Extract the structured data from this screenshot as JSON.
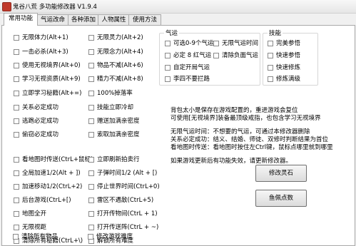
{
  "window": {
    "title": "鬼谷八荒 多功能修改器  V1.9.4"
  },
  "tabs": [
    "常用功能",
    "气运改命",
    "各种添加",
    "人物属性",
    "使用方法"
  ],
  "left_col": [
    "无限体力(Alt+1)",
    "一击必杀(Alt+3)",
    "使用无视境界(Alt+0)",
    "学习无视资质(Alt+9)",
    "立即学习秘籍(Alt+=)",
    "关系必定成功",
    "逃跑必定成功",
    "偷窃必定成功"
  ],
  "mid_col": [
    "无限灵力(Alt+2)",
    "无限念力(Alt+4)",
    "物品不减(Alt+6)",
    "精力不减(Alt+8)",
    "100%掉落率",
    "技能立即冷却",
    "赠送加满亲密度",
    "索取加满亲密度"
  ],
  "left_col2": [
    "看地图时传送(CtrL+鼠标)",
    "全局加速1/2(Alt + ])",
    "加速移动1/2(CtrL+2)",
    "后台游戏(CtrL+[)",
    "地图全开",
    "无限视距",
    "清除所有秘籍(CtrL+\\)",
    "清除所有物品"
  ],
  "mid_col2": [
    "立即刷新拍卖行",
    "子弹时间1/2 (Alt + [)",
    "停止世界时间(CtrL+0)",
    "雷区不遇敌(CtrL+5)",
    "打开传物间(CtrL + 1)",
    "打开传送阵(CtrL + ~)",
    "解锁所有难度",
    "修改游戏难度"
  ],
  "luck": {
    "title": "气运",
    "items": [
      "可选0-9个气运",
      "无限气运时间",
      "必定 8 红气运",
      "清除负面气运",
      "自定开局气运",
      "李四不要拦路"
    ]
  },
  "skills": {
    "title": "技能",
    "items": [
      "完美参悟",
      "快速参悟",
      "快速修炼",
      "修炼满级"
    ]
  },
  "info": {
    "l1": "背包太小是保存在游戏配置的，重进游戏会复位",
    "l2": "可使用[无视境界]装备最顶级戒指，也包含学习无视境界",
    "l3": "无限气运时间：不想要的气运，可通过本修改器删除",
    "l4": "关系必定成功：结义、结婚、师徒、双修时判断结果为首位",
    "l5": "看地图时传送：看地图时按住左Ctrl键，鼠标点哪里就到哪里",
    "l6": "如果游戏更新后有功能失效，请更新修改器。"
  },
  "buttons": {
    "modify_stone": "修改灵石",
    "fish_points": "鱼佩点数"
  }
}
